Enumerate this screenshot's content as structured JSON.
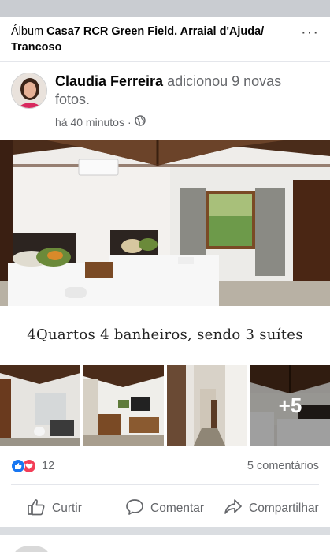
{
  "header": {
    "prefix": "Álbum ",
    "album_name": "Casa7 RCR Green Field. Arraial d'Ajuda/ Trancoso"
  },
  "post": {
    "author": "Claudia Ferreira",
    "action_text": " adicionou 9 novas fotos.",
    "time": "há 40 minutos",
    "separator": "·",
    "privacy_icon": "globe-icon"
  },
  "caption": "4Quartos 4 banheiros,  sendo 3 suítes",
  "thumbnails": {
    "more_overlay": "+5"
  },
  "reactions": {
    "icons": [
      "like-icon",
      "love-icon"
    ],
    "count": "12",
    "comments": "5 comentários"
  },
  "actions": {
    "like": "Curtir",
    "comment": "Comentar",
    "share": "Compartilhar"
  },
  "colors": {
    "like_blue": "#1877f2",
    "love_red": "#f33e58",
    "secondary_text": "#65676b"
  }
}
